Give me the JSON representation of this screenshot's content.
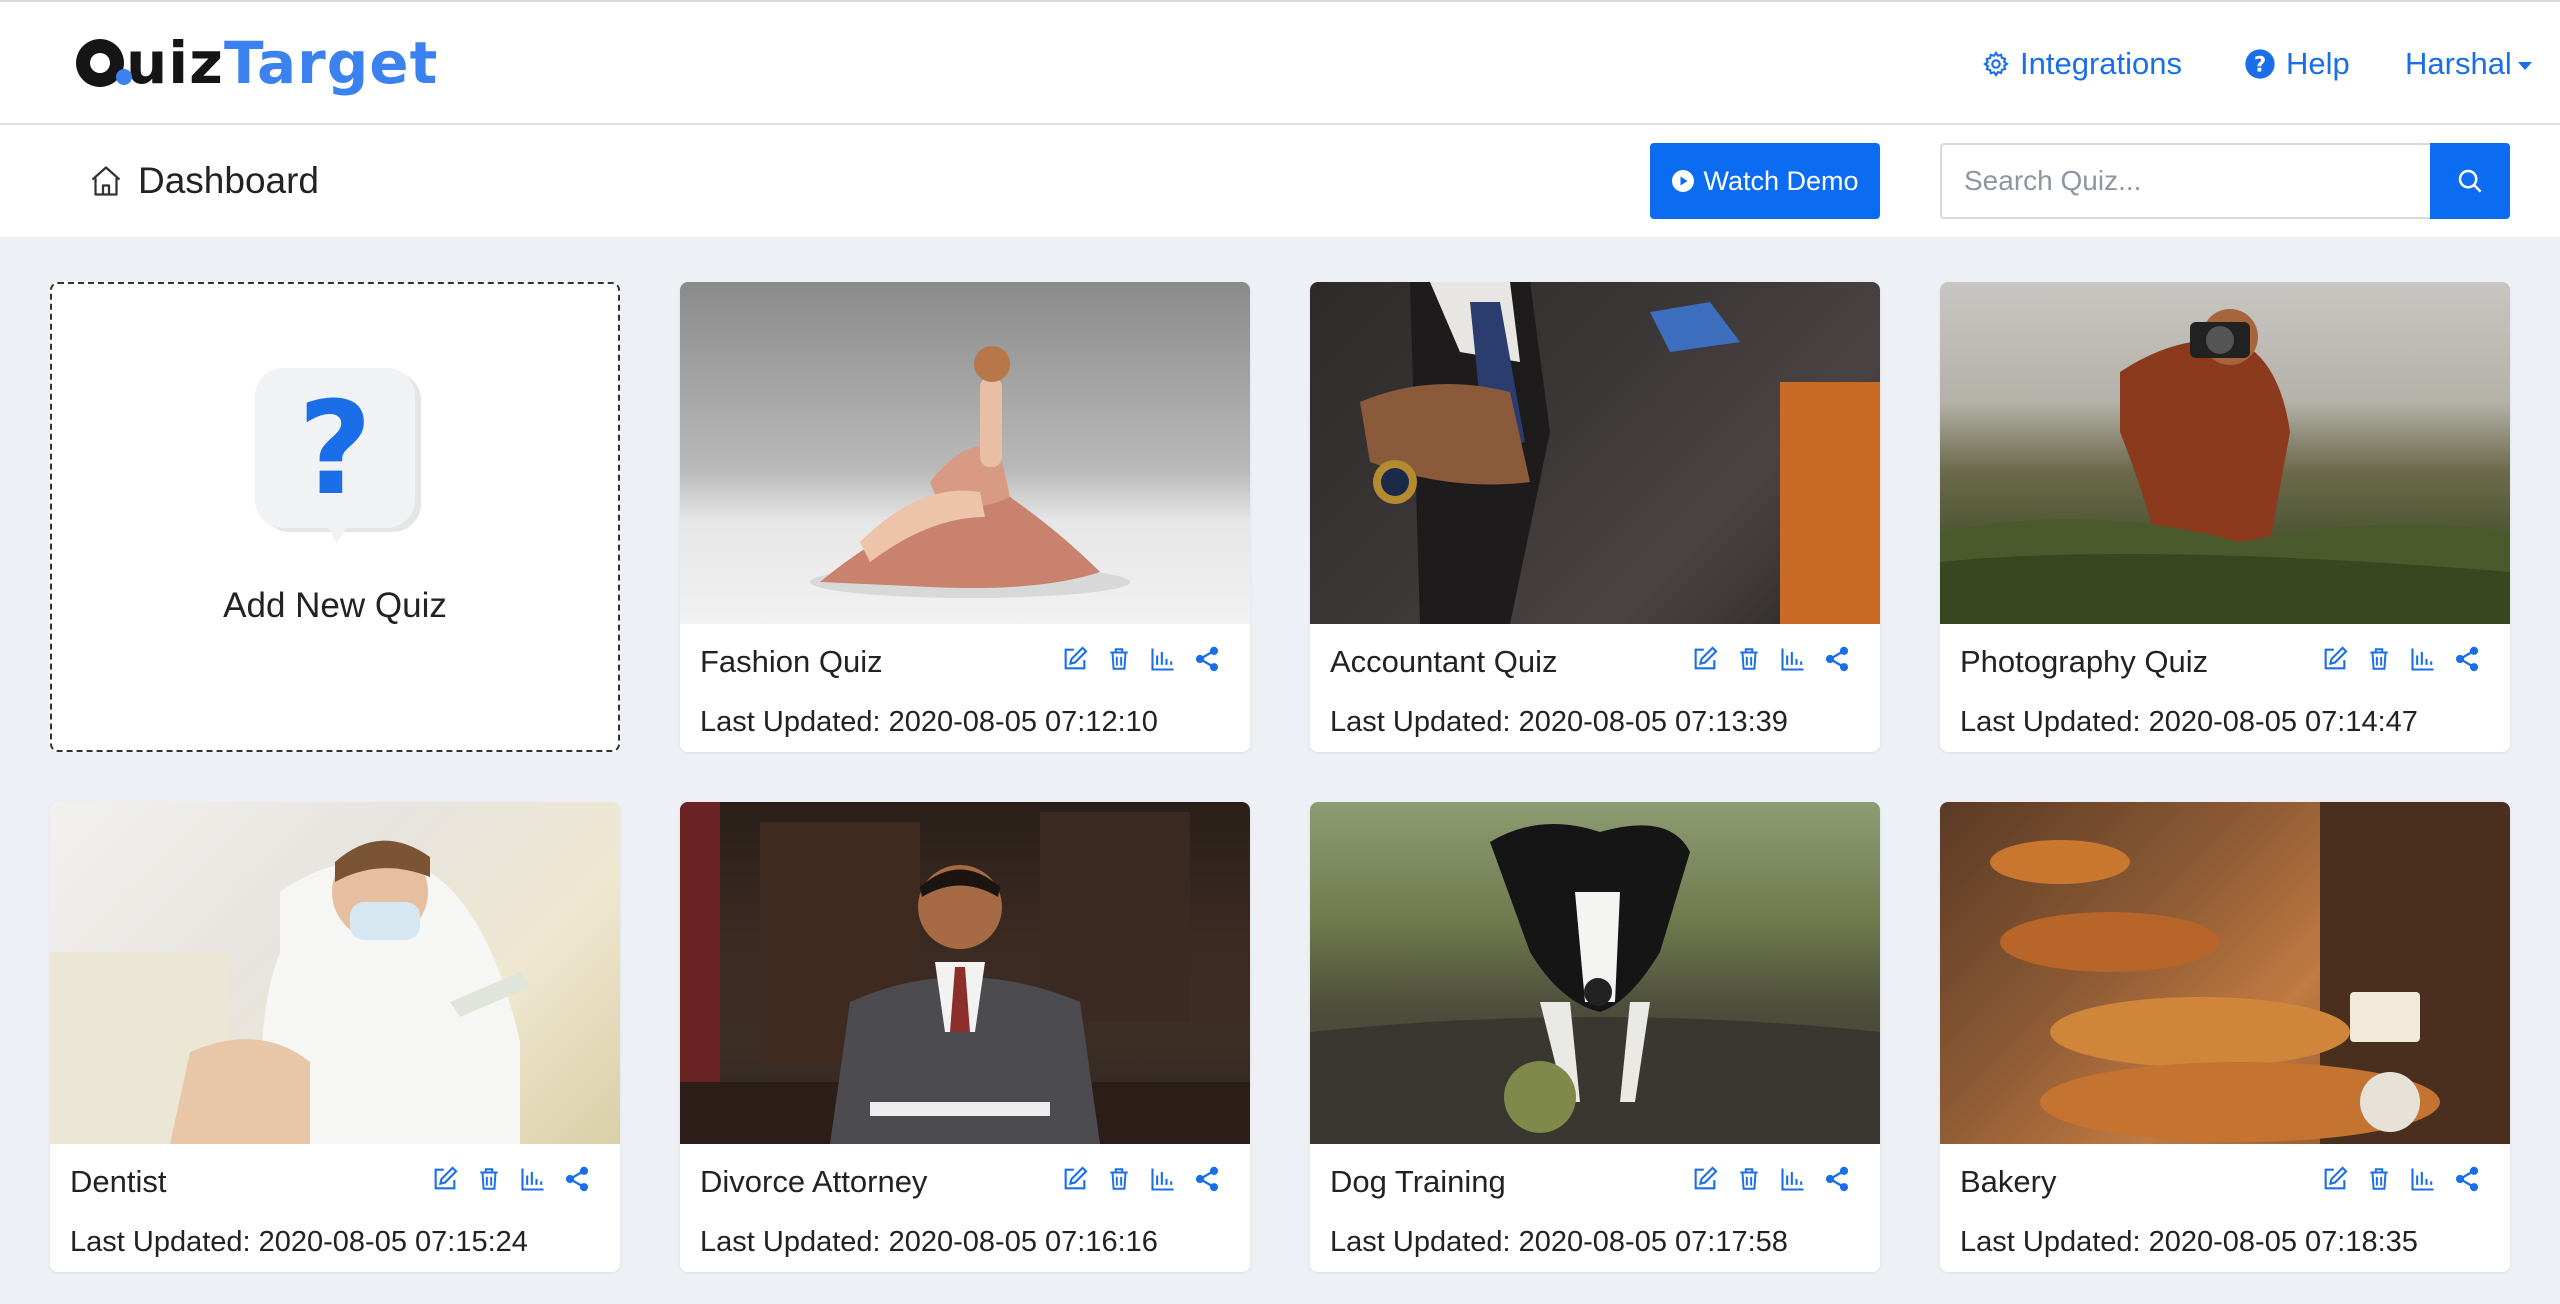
{
  "header": {
    "logo_dark": "uiz",
    "logo_blue": "Target",
    "nav": {
      "integrations": "Integrations",
      "help": "Help",
      "user": "Harshal"
    }
  },
  "subheader": {
    "breadcrumb": "Dashboard",
    "watch_demo": "Watch Demo",
    "search_placeholder": "Search Quiz..."
  },
  "add_card": {
    "label": "Add New Quiz"
  },
  "quizzes": [
    {
      "title": "Fashion Quiz",
      "updated": "Last Updated: 2020-08-05 07:12:10"
    },
    {
      "title": "Accountant Quiz",
      "updated": "Last Updated: 2020-08-05 07:13:39"
    },
    {
      "title": "Photography Quiz",
      "updated": "Last Updated: 2020-08-05 07:14:47"
    },
    {
      "title": "Dentist",
      "updated": "Last Updated: 2020-08-05 07:15:24"
    },
    {
      "title": "Divorce Attorney",
      "updated": "Last Updated: 2020-08-05 07:16:16"
    },
    {
      "title": "Dog Training",
      "updated": "Last Updated: 2020-08-05 07:17:58"
    },
    {
      "title": "Bakery",
      "updated": "Last Updated: 2020-08-05 07:18:35"
    }
  ],
  "colors": {
    "accent": "#0b6cf1",
    "link": "#1a6fe8",
    "background": "#edf0f5"
  },
  "icons": [
    "gear-icon",
    "help-circle-icon",
    "home-icon",
    "play-circle-icon",
    "search-icon",
    "edit-icon",
    "trash-icon",
    "bar-chart-icon",
    "share-icon"
  ]
}
